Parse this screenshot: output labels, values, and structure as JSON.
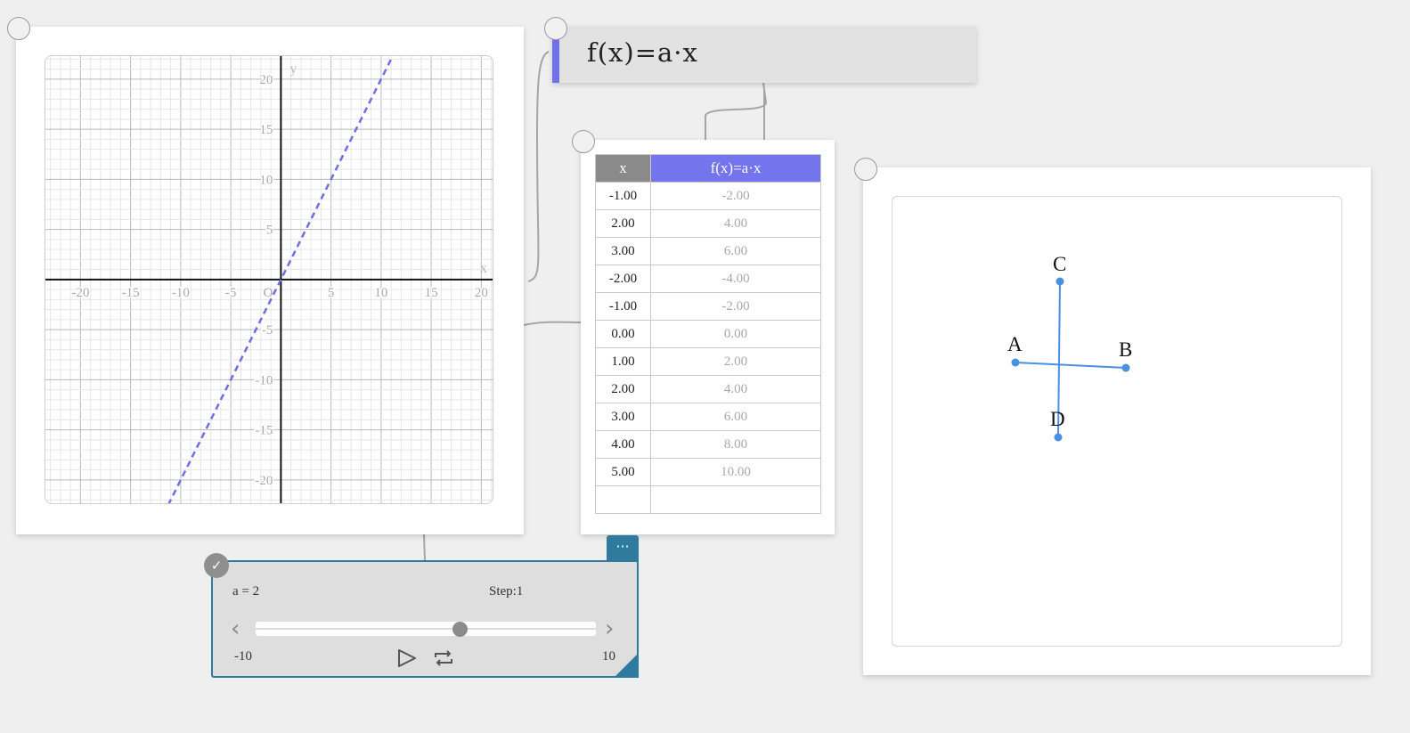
{
  "graph": {
    "x_ticks": [
      -20,
      -15,
      -10,
      -5,
      5,
      10,
      15,
      20
    ],
    "y_ticks": [
      20,
      15,
      10,
      5,
      -5,
      -10,
      -15,
      -20
    ],
    "x_axis_label": "x",
    "y_axis_label": "y",
    "origin_label": "O",
    "line_color": "#6e6ee6",
    "axis_range": {
      "x": [
        -23.5,
        21.3
      ],
      "y": [
        -22.5,
        22.3
      ]
    },
    "function": {
      "expression": "f(x) = a·x",
      "slope_a": 2
    }
  },
  "formula": {
    "text": "f(x)=a·x",
    "accent_color": "#7070e8"
  },
  "table": {
    "headers": [
      "x",
      "f(x)=a·x"
    ],
    "rows": [
      [
        "-1.00",
        "-2.00"
      ],
      [
        "2.00",
        "4.00"
      ],
      [
        "3.00",
        "6.00"
      ],
      [
        "-2.00",
        "-4.00"
      ],
      [
        "-1.00",
        "-2.00"
      ],
      [
        "0.00",
        "0.00"
      ],
      [
        "1.00",
        "2.00"
      ],
      [
        "2.00",
        "4.00"
      ],
      [
        "3.00",
        "6.00"
      ],
      [
        "4.00",
        "8.00"
      ],
      [
        "5.00",
        "10.00"
      ],
      [
        "",
        ""
      ]
    ]
  },
  "geometry": {
    "point_color": "#4a90e2",
    "points": [
      {
        "label": "A"
      },
      {
        "label": "B"
      },
      {
        "label": "C"
      },
      {
        "label": "D"
      }
    ]
  },
  "slider": {
    "value_text": "a = 2",
    "step_text": "Step:1",
    "min_label": "-10",
    "max_label": "10",
    "value": 2,
    "min": -10,
    "max": 10,
    "menu_icon": "ellipsis-icon",
    "check_icon": "check-icon",
    "frame_color": "#2e7b9f"
  }
}
